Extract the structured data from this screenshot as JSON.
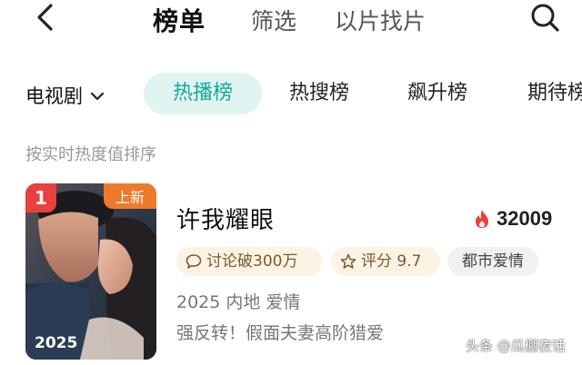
{
  "header": {
    "title": "榜单",
    "tabs": [
      "筛选",
      "以片找片"
    ],
    "back_icon": "chevron-left-icon",
    "search_icon": "search-icon"
  },
  "category": {
    "dropdown_label": "电视剧",
    "chips": [
      "热播榜",
      "热搜榜",
      "飙升榜",
      "期待榜"
    ],
    "active_chip": "热播榜",
    "accent": "#18a79b"
  },
  "sort_hint": "按实时热度值排序",
  "item": {
    "rank": "1",
    "badge": "上新",
    "poster_year": "2025",
    "title": "许我耀眼",
    "heat": "32009",
    "tags": {
      "discuss": "讨论破300万",
      "score": "评分 9.7",
      "genre": "都市爱情"
    },
    "meta": "2025 内地 爱情",
    "description": "强反转！假面夫妻高阶猎爱"
  },
  "watermark": "头条 @瓜棚夜话",
  "colors": {
    "rank_badge": "#e8413b",
    "new_badge": "#ee7a2a",
    "flame": "#e8413b"
  }
}
